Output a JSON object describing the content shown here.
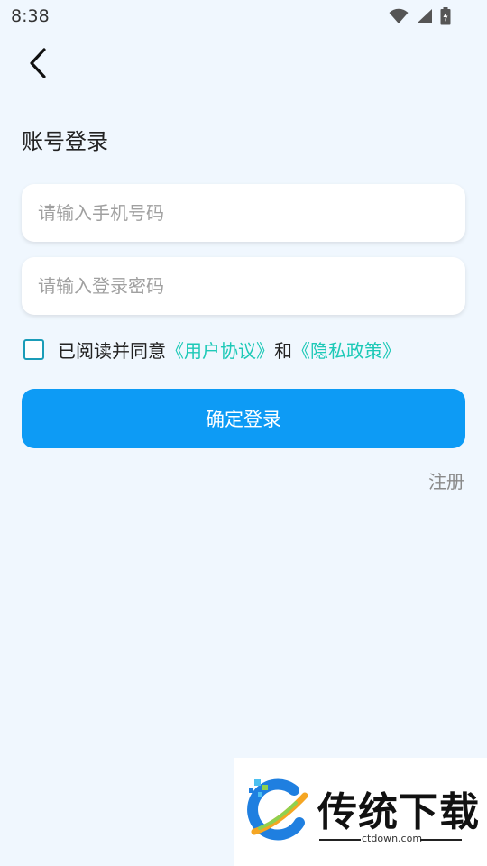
{
  "status_bar": {
    "time": "8:38"
  },
  "header": {
    "title": "账号登录"
  },
  "form": {
    "phone_placeholder": "请输入手机号码",
    "password_placeholder": "请输入登录密码"
  },
  "agreement": {
    "checked": false,
    "prefix": "已阅读并同意",
    "user_agreement": "《用户协议》",
    "conjunction": "和",
    "privacy_policy": "《隐私政策》"
  },
  "actions": {
    "login_label": "确定登录",
    "register_label": "注册"
  },
  "watermark": {
    "title": "传统下载",
    "url": "ctdown.com"
  },
  "colors": {
    "background": "#f0f7fe",
    "primary": "#0d9bf5",
    "link": "#1dc9b7",
    "muted": "#8a8a8a"
  }
}
